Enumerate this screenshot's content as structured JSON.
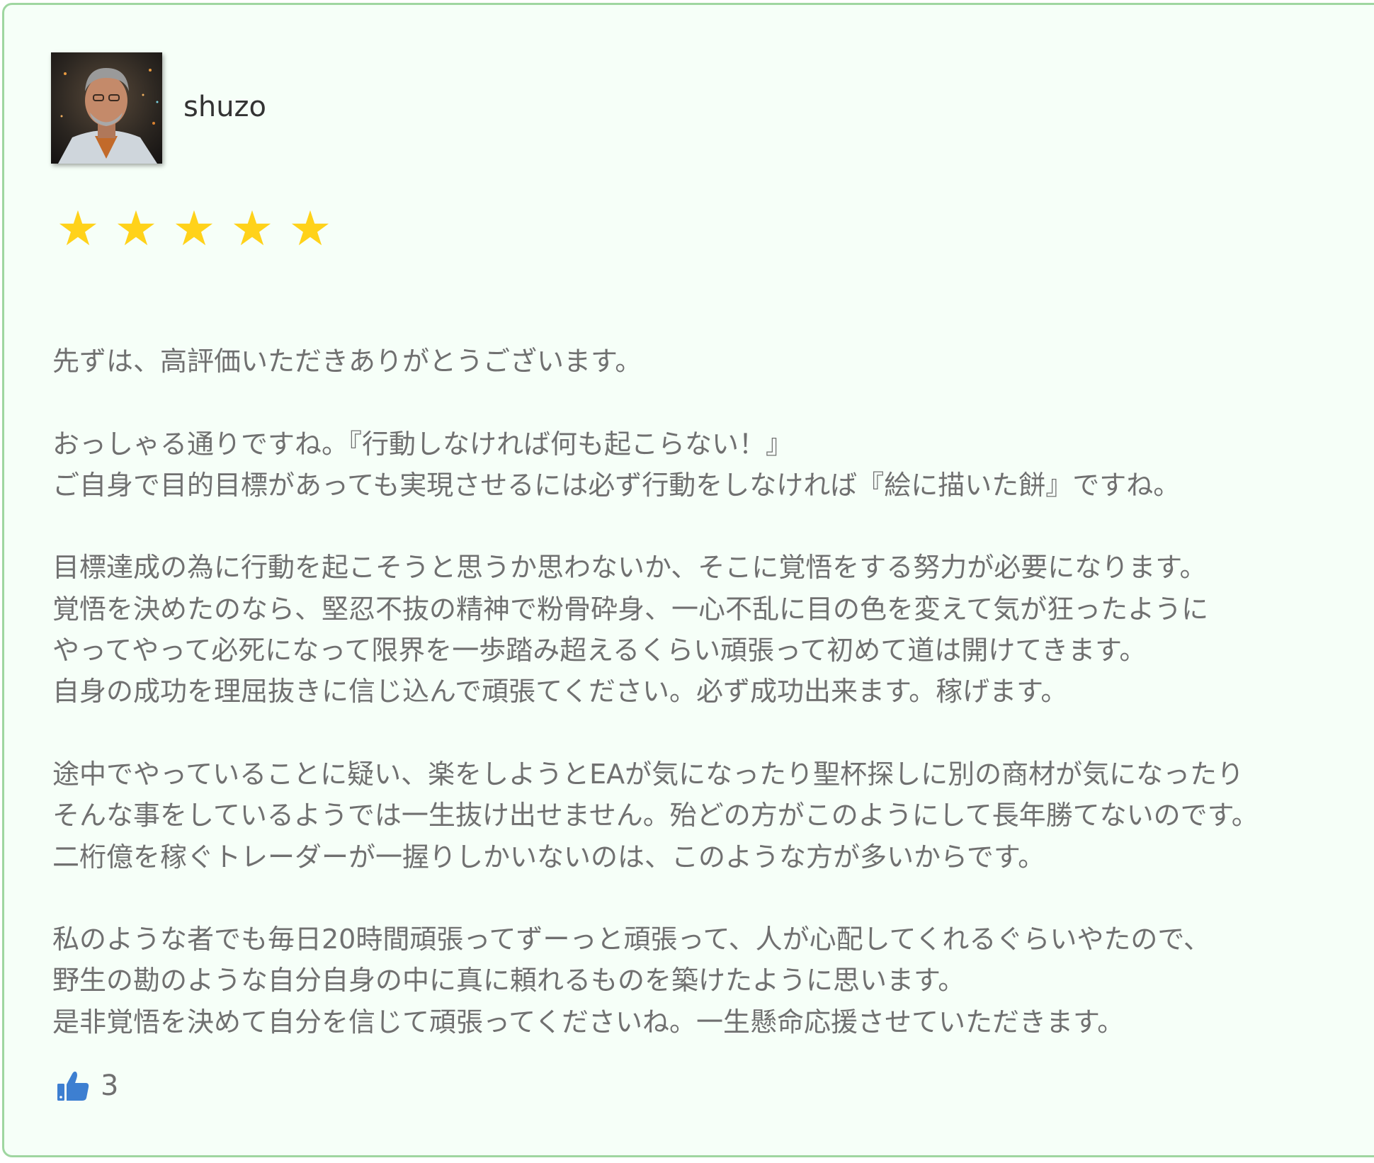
{
  "review": {
    "username": "shuzo",
    "rating": 5,
    "star_glyph": "★",
    "star_color": "#ffd21a",
    "paragraphs": [
      [
        "先ずは、高評価いただきありがとうございます。"
      ],
      [
        "おっしゃる通りですね。『行動しなければ何も起こらない！』",
        "ご自身で目的目標があっても実現させるには必ず行動をしなければ『絵に描いた餅』ですね。"
      ],
      [
        "目標達成の為に行動を起こそうと思うか思わないか、そこに覚悟をする努力が必要になります。",
        "覚悟を決めたのなら、堅忍不抜の精神で粉骨砕身、一心不乱に目の色を変えて気が狂ったように",
        "やってやって必死になって限界を一歩踏み超えるくらい頑張って初めて道は開けてきます。",
        "自身の成功を理屈抜きに信じ込んで頑張てください。必ず成功出来ます。稼げます。"
      ],
      [
        "途中でやっていることに疑い、楽をしようとEAが気になったり聖杯探しに別の商材が気になったり",
        "そんな事をしているようでは一生抜け出せません。殆どの方がこのようにして長年勝てないのです。",
        "二桁億を稼ぐトレーダーが一握りしかいないのは、このような方が多いからです。"
      ],
      [
        "私のような者でも毎日20時間頑張ってずーっと頑張って、人が心配してくれるぐらいやたので、",
        "野生の勘のような自分自身の中に真に頼れるものを築けたように思います。",
        "是非覚悟を決めて自分を信じて頑張ってくださいね。一生懸命応援させていただきます。"
      ]
    ],
    "likes": {
      "icon": "thumbs-up-icon",
      "count": "3",
      "icon_color": "#3d7fd1"
    },
    "border_color": "#9fd6a0",
    "background_color": "#f6fff8"
  }
}
